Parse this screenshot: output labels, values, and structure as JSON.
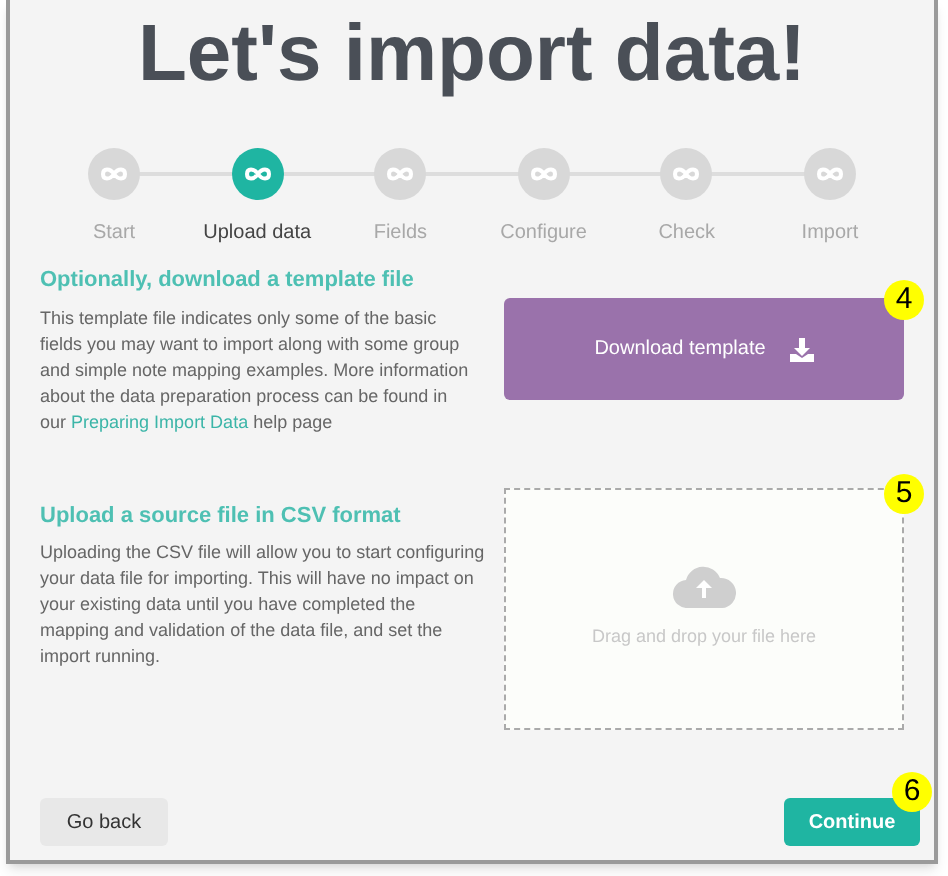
{
  "title": "Let's import data!",
  "steps": [
    {
      "label": "Start",
      "selected": false
    },
    {
      "label": "Upload data",
      "selected": true
    },
    {
      "label": "Fields",
      "selected": false
    },
    {
      "label": "Configure",
      "selected": false
    },
    {
      "label": "Check",
      "selected": false
    },
    {
      "label": "Import",
      "selected": false
    }
  ],
  "template_section": {
    "heading": "Optionally, download a template file",
    "text_before": "This template file indicates only some of the basic fields you may want to import along with some group and simple note mapping examples. More information about the data preparation process can be found in our",
    "link": "Preparing Import Data",
    "text_after": "help page",
    "button": "Download template",
    "callout": "4"
  },
  "upload_section": {
    "heading": "Upload a source file in CSV format",
    "text": "Uploading the CSV file will allow you to start configuring your data file for importing. This will have no impact on your existing data until you have completed the mapping and validation of the data file, and set the import running.",
    "dropzone": "Drag and drop your file here",
    "callout": "5"
  },
  "footer": {
    "back": "Go back",
    "continue": "Continue",
    "callout": "6"
  }
}
